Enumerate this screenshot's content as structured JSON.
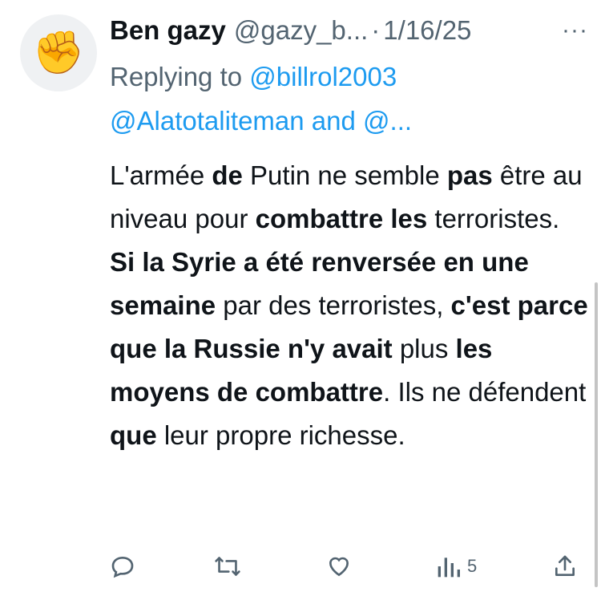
{
  "author": {
    "avatar_icon": "raised-fist-icon",
    "avatar_glyph": "✊",
    "name": "Ben gazy",
    "handle": "@gazy_b...",
    "separator": "·",
    "date": "1/16/25",
    "more_label": "···"
  },
  "reply": {
    "prefix": "Replying to ",
    "mention1": "@billrol2003",
    "mention2": "@Alatotaliteman",
    "joiner": " and ",
    "mention3": "@..."
  },
  "tweet_segments": [
    {
      "text": "L'armée ",
      "bold": false
    },
    {
      "text": "de",
      "bold": true
    },
    {
      "text": " Putin ne semble ",
      "bold": false
    },
    {
      "text": "pas",
      "bold": true
    },
    {
      "text": " être au niveau pour ",
      "bold": false
    },
    {
      "text": "combattre les",
      "bold": true
    },
    {
      "text": " terroristes. ",
      "bold": false
    },
    {
      "text": "Si la Syrie a été renversée en une semaine",
      "bold": true
    },
    {
      "text": " par des terroristes, ",
      "bold": false
    },
    {
      "text": "c'est parce que la Russie n'y avait",
      "bold": true
    },
    {
      "text": " plus ",
      "bold": false
    },
    {
      "text": "les moyens de combattre",
      "bold": true
    },
    {
      "text": ". Ils ne défendent ",
      "bold": false
    },
    {
      "text": "que",
      "bold": true
    },
    {
      "text": " leur propre richesse.",
      "bold": false
    }
  ],
  "actions": {
    "reply_icon": "reply-icon",
    "retweet_icon": "retweet-icon",
    "like_icon": "heart-icon",
    "views_icon": "views-icon",
    "views_count": "5",
    "share_icon": "share-icon"
  },
  "colors": {
    "text": "#0f1419",
    "secondary": "#536471",
    "link": "#1d9bf0"
  }
}
